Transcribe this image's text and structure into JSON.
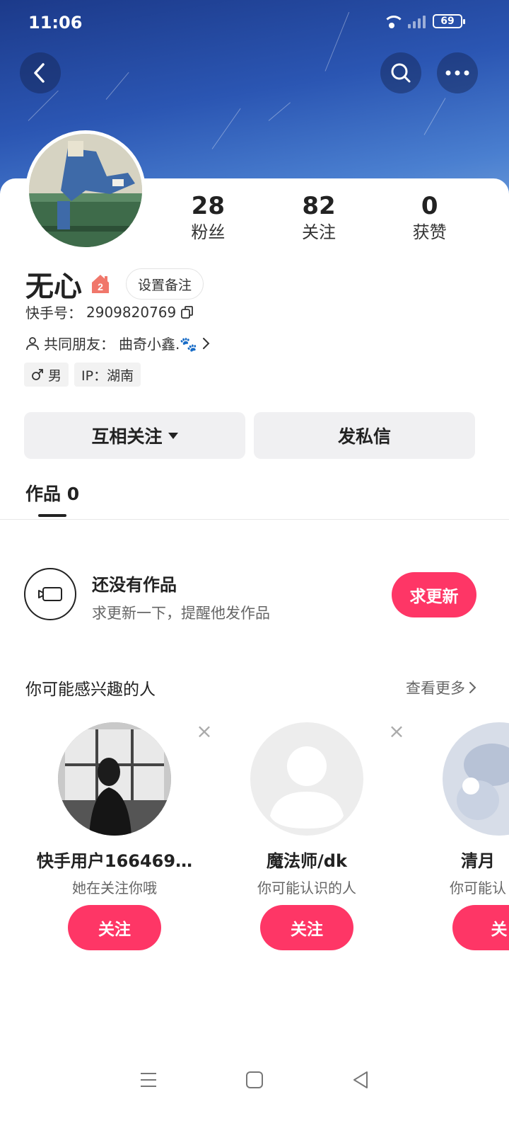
{
  "status_bar": {
    "time": "11:06",
    "battery": "69",
    "wifi_badge": "×"
  },
  "header": {
    "back_icon": "back-arrow",
    "search_icon": "search",
    "more_icon": "more-dots"
  },
  "profile": {
    "name": "无心",
    "level": "2",
    "remark_button": "设置备注",
    "id_label": "快手号：",
    "id_value": "2909820769",
    "mutual_label": "共同朋友：",
    "mutual_value": "曲奇小鑫.🐾",
    "gender": "男",
    "ip": "IP：湖南"
  },
  "stats": [
    {
      "num": "28",
      "label": "粉丝"
    },
    {
      "num": "82",
      "label": "关注"
    },
    {
      "num": "0",
      "label": "获赞"
    }
  ],
  "actions": {
    "follow_state": "互相关注",
    "message": "发私信"
  },
  "tabs": {
    "works": "作品 0"
  },
  "empty": {
    "title": "还没有作品",
    "subtitle": "求更新一下，提醒他发作品",
    "request_button": "求更新"
  },
  "interest": {
    "title": "你可能感兴趣的人",
    "see_more": "查看更多",
    "people": [
      {
        "name": "快手用户166469…",
        "sub": "她在关注你哦",
        "follow": "关注"
      },
      {
        "name": "魔法师/dk",
        "sub": "你可能认识的人",
        "follow": "关注"
      },
      {
        "name": "清月",
        "sub": "你可能认",
        "follow": "关"
      }
    ]
  },
  "colors": {
    "accent": "#fe3666",
    "banner": "#2b56b3"
  }
}
